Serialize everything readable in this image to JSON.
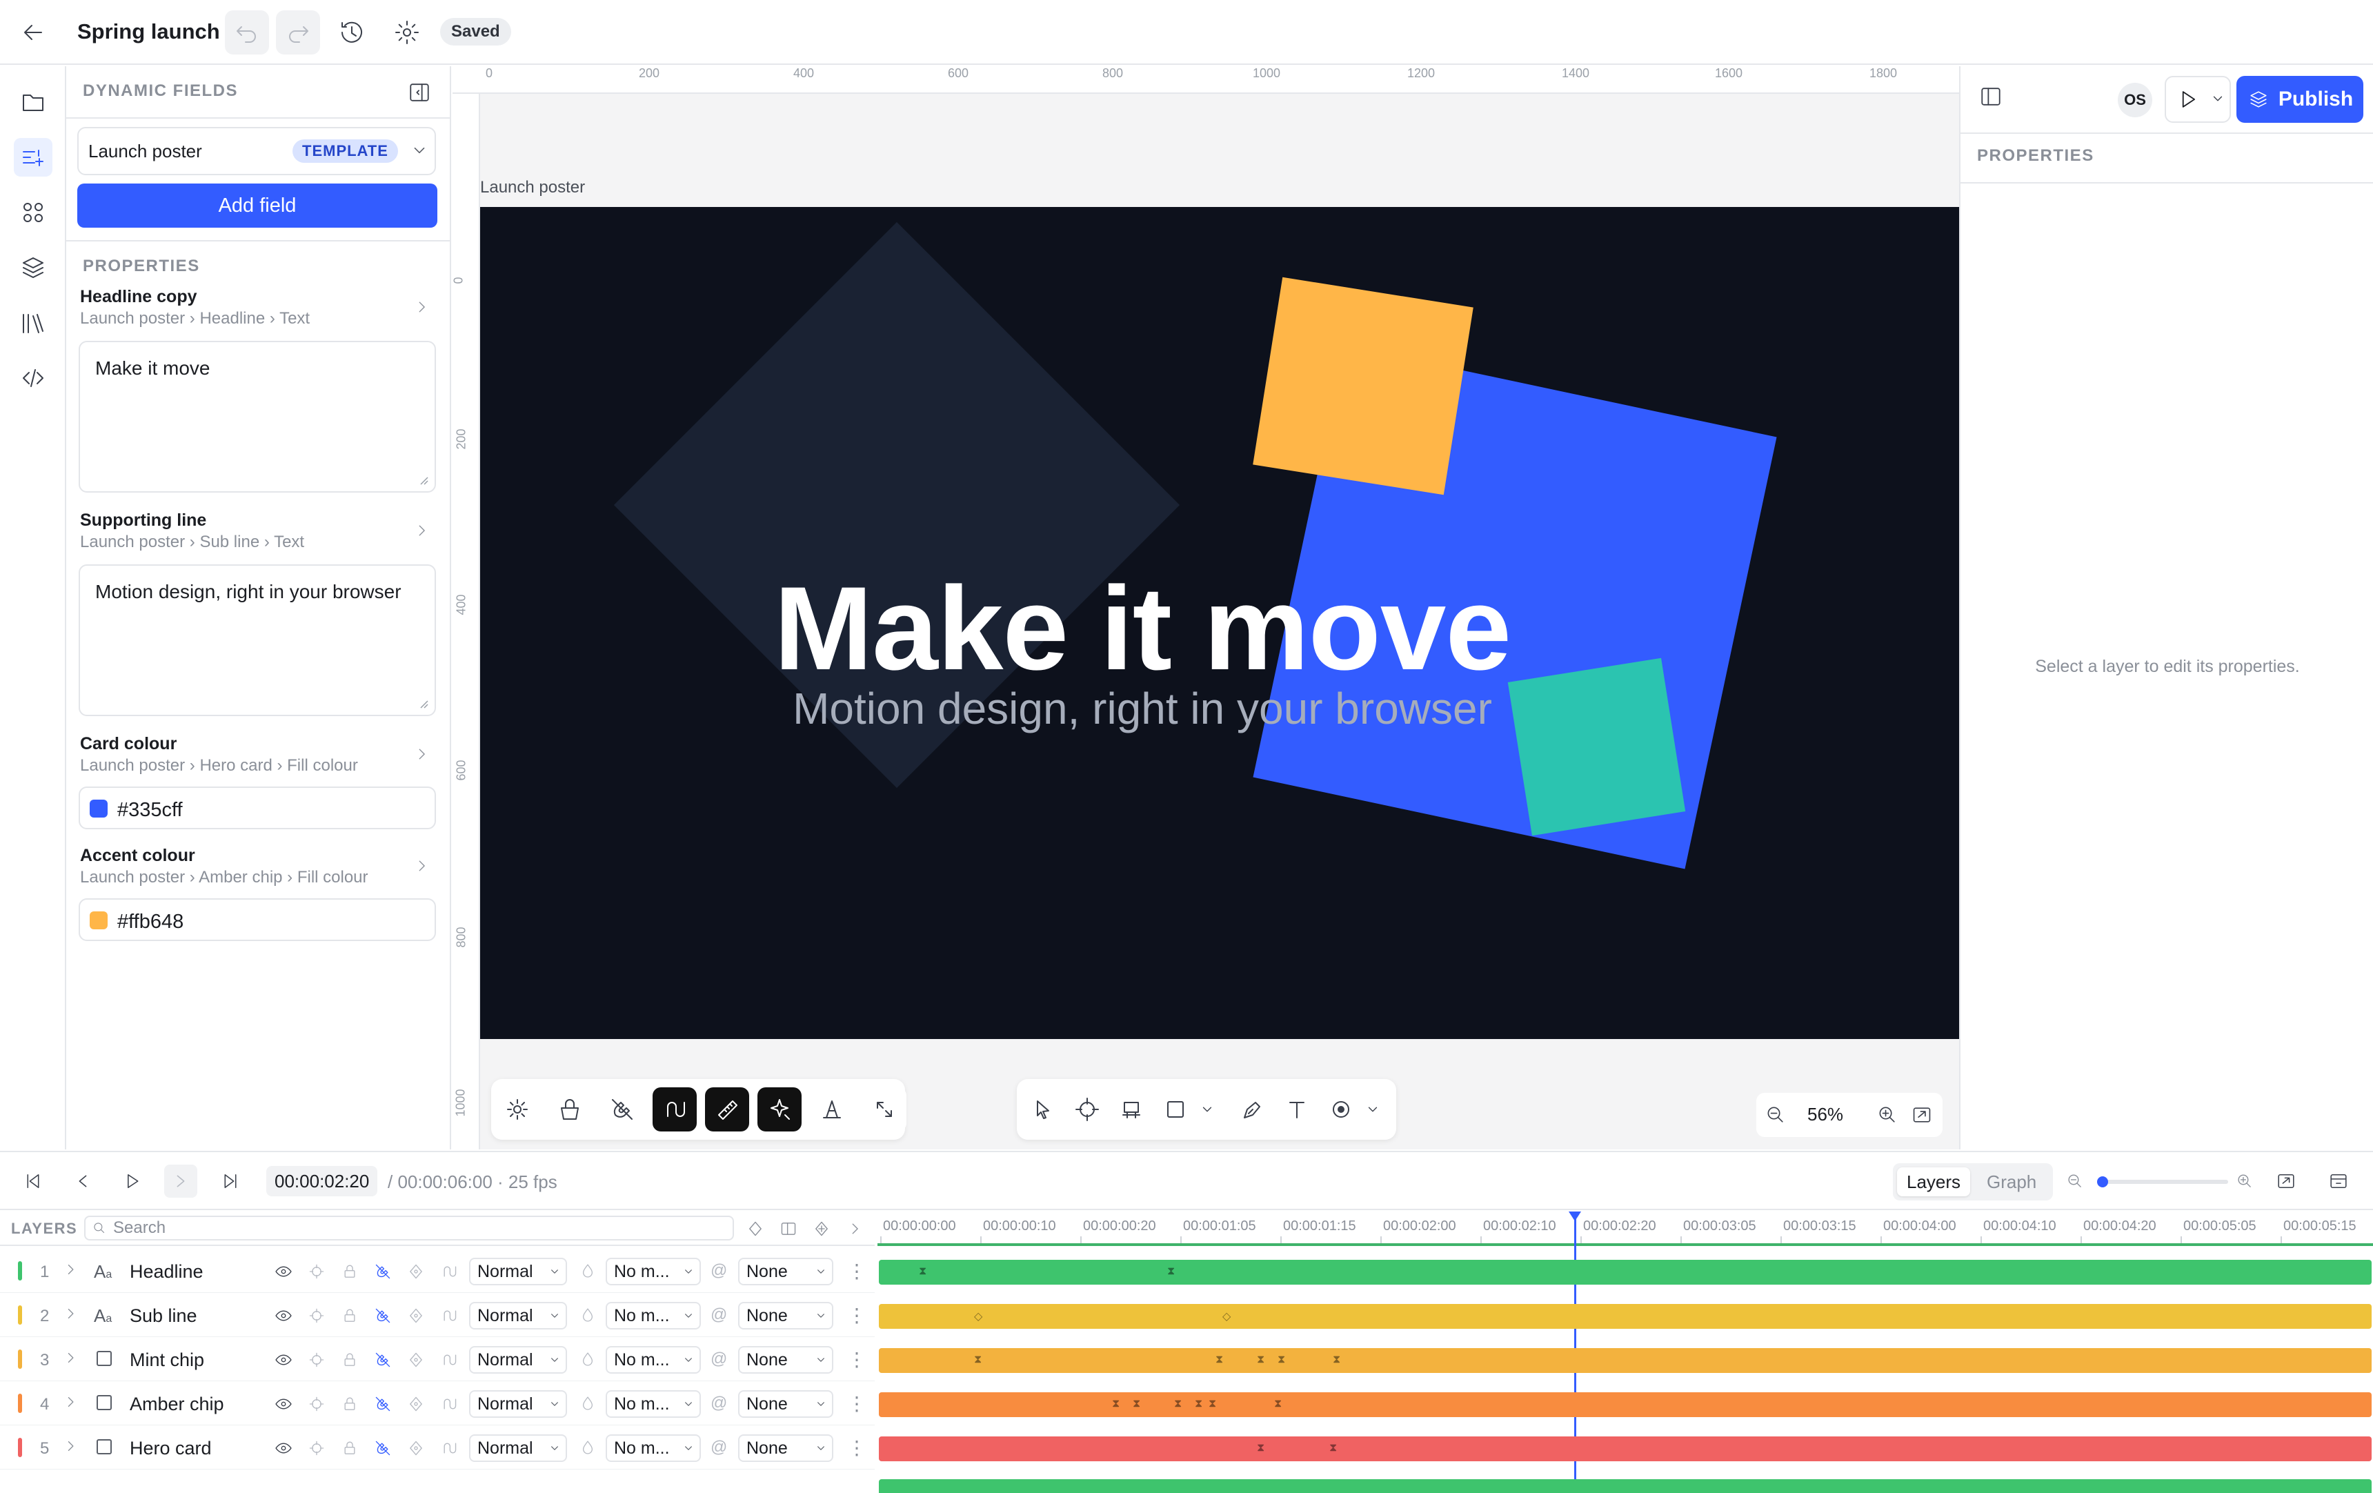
{
  "app": {
    "document_title": "Spring launch",
    "status": "Saved"
  },
  "df": {
    "heading": "DYNAMIC FIELDS",
    "selected_template": "Launch poster",
    "template_badge": "TEMPLATE",
    "add_field_label": "Add field",
    "properties_heading": "PROPERTIES",
    "fields": [
      {
        "title": "Headline copy",
        "path": "Launch poster › Headline › Text",
        "value": "Make it move"
      },
      {
        "title": "Supporting line",
        "path": "Launch poster › Sub line › Text",
        "value": "Motion design, right in your browser"
      },
      {
        "title": "Card colour",
        "path": "Launch poster › Hero card › Fill colour",
        "value": "#335cff"
      },
      {
        "title": "Accent colour",
        "path": "Launch poster › Amber chip › Fill colour",
        "value": "#ffb648"
      }
    ]
  },
  "canvas": {
    "artboard_label": "Launch poster",
    "headline": "Make it move",
    "subline": "Motion design, right in your browser",
    "ruler_h": [
      "0",
      "200",
      "400",
      "600",
      "800",
      "1000",
      "1200",
      "1400",
      "1600",
      "1800"
    ],
    "ruler_v": [
      "0",
      "200",
      "400",
      "600",
      "800",
      "1000"
    ],
    "zoom": "56%"
  },
  "right": {
    "avatar": "OS",
    "publish_label": "Publish",
    "properties_heading": "PROPERTIES",
    "empty_hint": "Select a layer to edit its properties."
  },
  "timeline": {
    "current_time": "00:00:02:20",
    "duration": "/ 00:00:06:00 · 25 fps",
    "tabs": [
      "Layers",
      "Graph"
    ],
    "layers_heading": "LAYERS",
    "search_placeholder": "Search",
    "ticks": [
      "00:00:00:00",
      "00:00:00:10",
      "00:00:00:20",
      "00:00:01:05",
      "00:00:01:15",
      "00:00:02:00",
      "00:00:02:10",
      "00:00:02:20",
      "00:00:03:05",
      "00:00:03:15",
      "00:00:04:00",
      "00:00:04:10",
      "00:00:04:20",
      "00:00:05:05",
      "00:00:05:15"
    ],
    "layers": [
      {
        "num": "1",
        "name": "Headline",
        "blend": "Normal",
        "matte": "No m...",
        "parent": "None",
        "color": "#3ec46d"
      },
      {
        "num": "2",
        "name": "Sub line",
        "blend": "Normal",
        "matte": "No m...",
        "parent": "None",
        "color": "#eec23a"
      },
      {
        "num": "3",
        "name": "Mint chip",
        "blend": "Normal",
        "matte": "No m...",
        "parent": "None",
        "color": "#f3b23e"
      },
      {
        "num": "4",
        "name": "Amber chip",
        "blend": "Normal",
        "matte": "No m...",
        "parent": "None",
        "color": "#f88c3f"
      },
      {
        "num": "5",
        "name": "Hero card",
        "blend": "Normal",
        "matte": "No m...",
        "parent": "None",
        "color": "#f06262"
      }
    ]
  },
  "colors": {
    "accent": "#335cff",
    "card": "#335cff",
    "amber": "#ffb648",
    "mint": "#2bc4b0",
    "artboard_bg": "#0d111c",
    "diamond": "#1a2233"
  }
}
